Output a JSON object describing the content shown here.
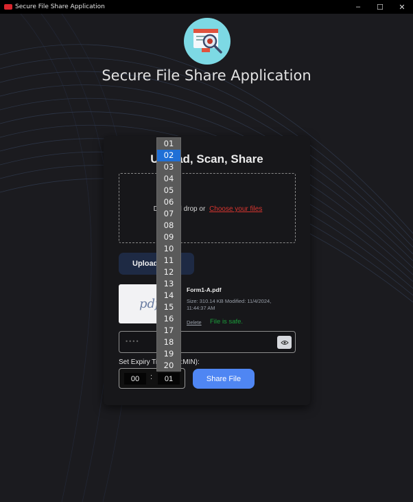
{
  "window": {
    "title": "Secure File Share Application",
    "minimize_glyph": "–",
    "maximize_glyph": "☐",
    "close_glyph": "✕"
  },
  "header": {
    "title": "Secure File Share Application",
    "icon": "bug-scan-icon"
  },
  "card": {
    "title": "Upload, Scan, Share",
    "dropzone_text": "Drag and drop or",
    "dropzone_link": "Choose your files",
    "upload_button": "Upload",
    "file": {
      "thumb_label": "pdf",
      "name": "Form1-A.pdf",
      "meta": "Size: 310.14 KB   Modified: 11/4/2024, 11:44:37 AM",
      "delete_label": "Delete",
      "status": "File is safe."
    },
    "password_dots": "••••",
    "expiry_label": "Set Expiry Time (HR:MIN):",
    "hours": "00",
    "separator": ":",
    "minutes": "01",
    "share_button": "Share File"
  },
  "minute_dropdown": {
    "options": [
      "01",
      "02",
      "03",
      "04",
      "05",
      "06",
      "07",
      "08",
      "09",
      "10",
      "11",
      "12",
      "13",
      "14",
      "15",
      "16",
      "17",
      "18",
      "19",
      "20"
    ],
    "highlighted": "02"
  },
  "colors": {
    "background": "#1b1b1f",
    "card": "#17171a",
    "accent_link": "#d9352f",
    "safe_status": "#1a9e3a",
    "share_button": "#4f86f3",
    "dropdown_highlight": "#1f6fd6"
  }
}
